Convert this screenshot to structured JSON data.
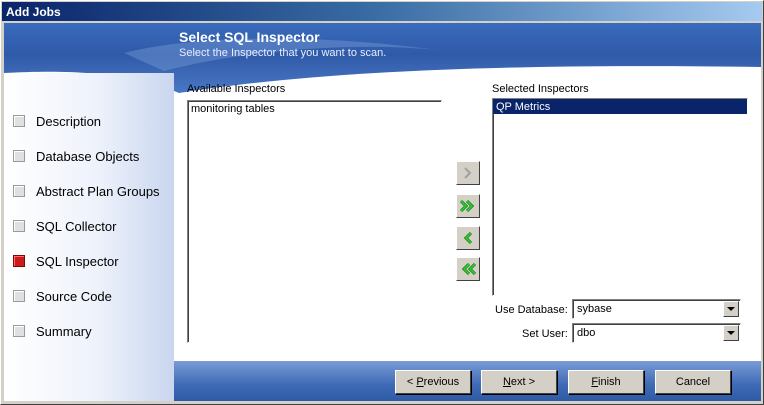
{
  "window": {
    "title": "Add Jobs"
  },
  "header": {
    "title": "Select SQL Inspector",
    "subtitle": "Select the Inspector that you want to scan."
  },
  "sidebar": {
    "items": [
      {
        "label": "Description",
        "active": false
      },
      {
        "label": "Database Objects",
        "active": false
      },
      {
        "label": "Abstract Plan Groups",
        "active": false
      },
      {
        "label": "SQL Collector",
        "active": false
      },
      {
        "label": "SQL Inspector",
        "active": true
      },
      {
        "label": "Source Code",
        "active": false
      },
      {
        "label": "Summary",
        "active": false
      }
    ]
  },
  "available": {
    "label": "Available Inspectors",
    "items": [
      "monitoring tables"
    ]
  },
  "selected": {
    "label": "Selected Inspectors",
    "items": [
      "QP Metrics"
    ]
  },
  "move_buttons": {
    "icons": [
      "chevron-right-icon",
      "double-chevron-right-icon",
      "chevron-left-icon",
      "double-chevron-left-icon"
    ]
  },
  "use_database": {
    "label": "Use Database:",
    "value": "sybase"
  },
  "set_user": {
    "label": "Set User:",
    "value": "dbo"
  },
  "buttons": {
    "previous_mnemonic": "P",
    "previous_rest": "revious",
    "next_mnemonic": "N",
    "next_rest": "ext >",
    "finish_mnemonic": "F",
    "finish_rest": "inish",
    "cancel": "Cancel"
  },
  "colors": {
    "accent": "#0a246a",
    "active_step": "#cc1b1b",
    "arrow_green": "#1fb51f"
  }
}
